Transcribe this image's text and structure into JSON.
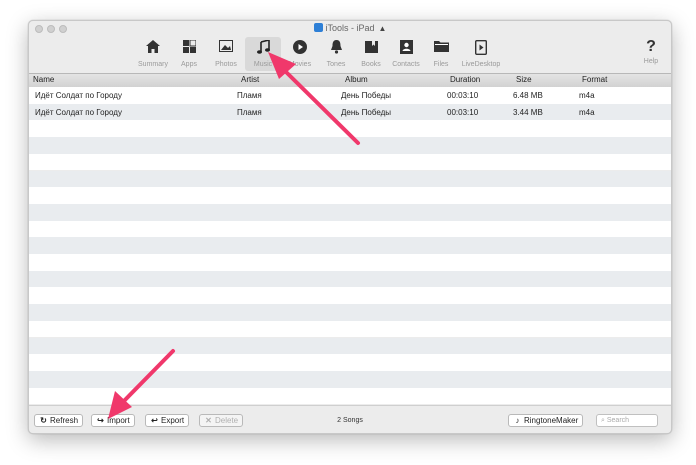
{
  "window": {
    "title": "iTools - iPad"
  },
  "toolbar": {
    "items": [
      {
        "label": "Summary",
        "icon": "home-icon"
      },
      {
        "label": "Apps",
        "icon": "apps-icon"
      },
      {
        "label": "Photos",
        "icon": "photo-icon"
      },
      {
        "label": "Music",
        "icon": "music-note-icon",
        "active": true
      },
      {
        "label": "Movies",
        "icon": "play-circle-icon"
      },
      {
        "label": "Tones",
        "icon": "bell-icon"
      },
      {
        "label": "Books",
        "icon": "book-icon"
      },
      {
        "label": "Contacts",
        "icon": "contacts-icon"
      },
      {
        "label": "Files",
        "icon": "folder-icon"
      },
      {
        "label": "LiveDesktop",
        "icon": "live-desktop-icon"
      }
    ],
    "help": {
      "label": "Help",
      "icon": "question-icon"
    }
  },
  "table": {
    "columns": [
      "Name",
      "Artist",
      "Album",
      "Duration",
      "Size",
      "Format"
    ],
    "rows": [
      {
        "name": "Идёт Солдат по Городу",
        "artist": "Пламя",
        "album": "День Победы",
        "duration": "00:03:10",
        "size": "6.48 MB",
        "format": "m4a"
      },
      {
        "name": "Идёт Солдат по Городу",
        "artist": "Пламя",
        "album": "День Победы",
        "duration": "00:03:10",
        "size": "3.44 MB",
        "format": "m4a"
      }
    ]
  },
  "bottom": {
    "refresh_label": "Refresh",
    "import_label": "Import",
    "export_label": "Export",
    "delete_label": "Delete",
    "song_count": "2 Songs",
    "ringtone_label": "RingtoneMaker",
    "search_placeholder": "Search"
  },
  "colors": {
    "annotation_arrow": "#f0386b",
    "row_stripe": "#e9ecef",
    "app_icon": "#2d7fd6"
  }
}
